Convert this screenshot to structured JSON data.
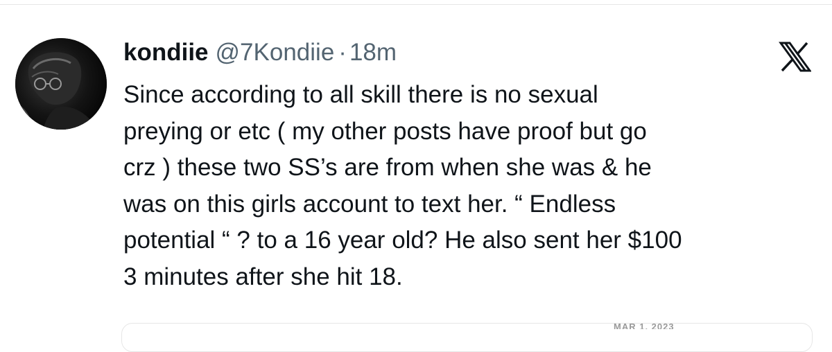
{
  "tweet": {
    "author_name": "kondiie",
    "author_handle": "@7Kondiie",
    "separator": "·",
    "time_ago": "18m",
    "avatar_icon": "profile-photo",
    "platform_icon": "x-logo-icon",
    "lines": [
      "Since according to all skill there is no sexual",
      "preying or etc ( my other posts have proof but go",
      "crz ) these two SS’s are from when she was & he",
      "was on this girls account to text her. “ Endless",
      "potential “ ? to a 16 year old? He also sent her $100",
      "3 minutes after she hit 18."
    ]
  },
  "embed": {
    "date_text": "MAR 1, 2023"
  },
  "colors": {
    "text": "#0f1419",
    "secondary": "#536471",
    "border": "#e6e6e6"
  }
}
